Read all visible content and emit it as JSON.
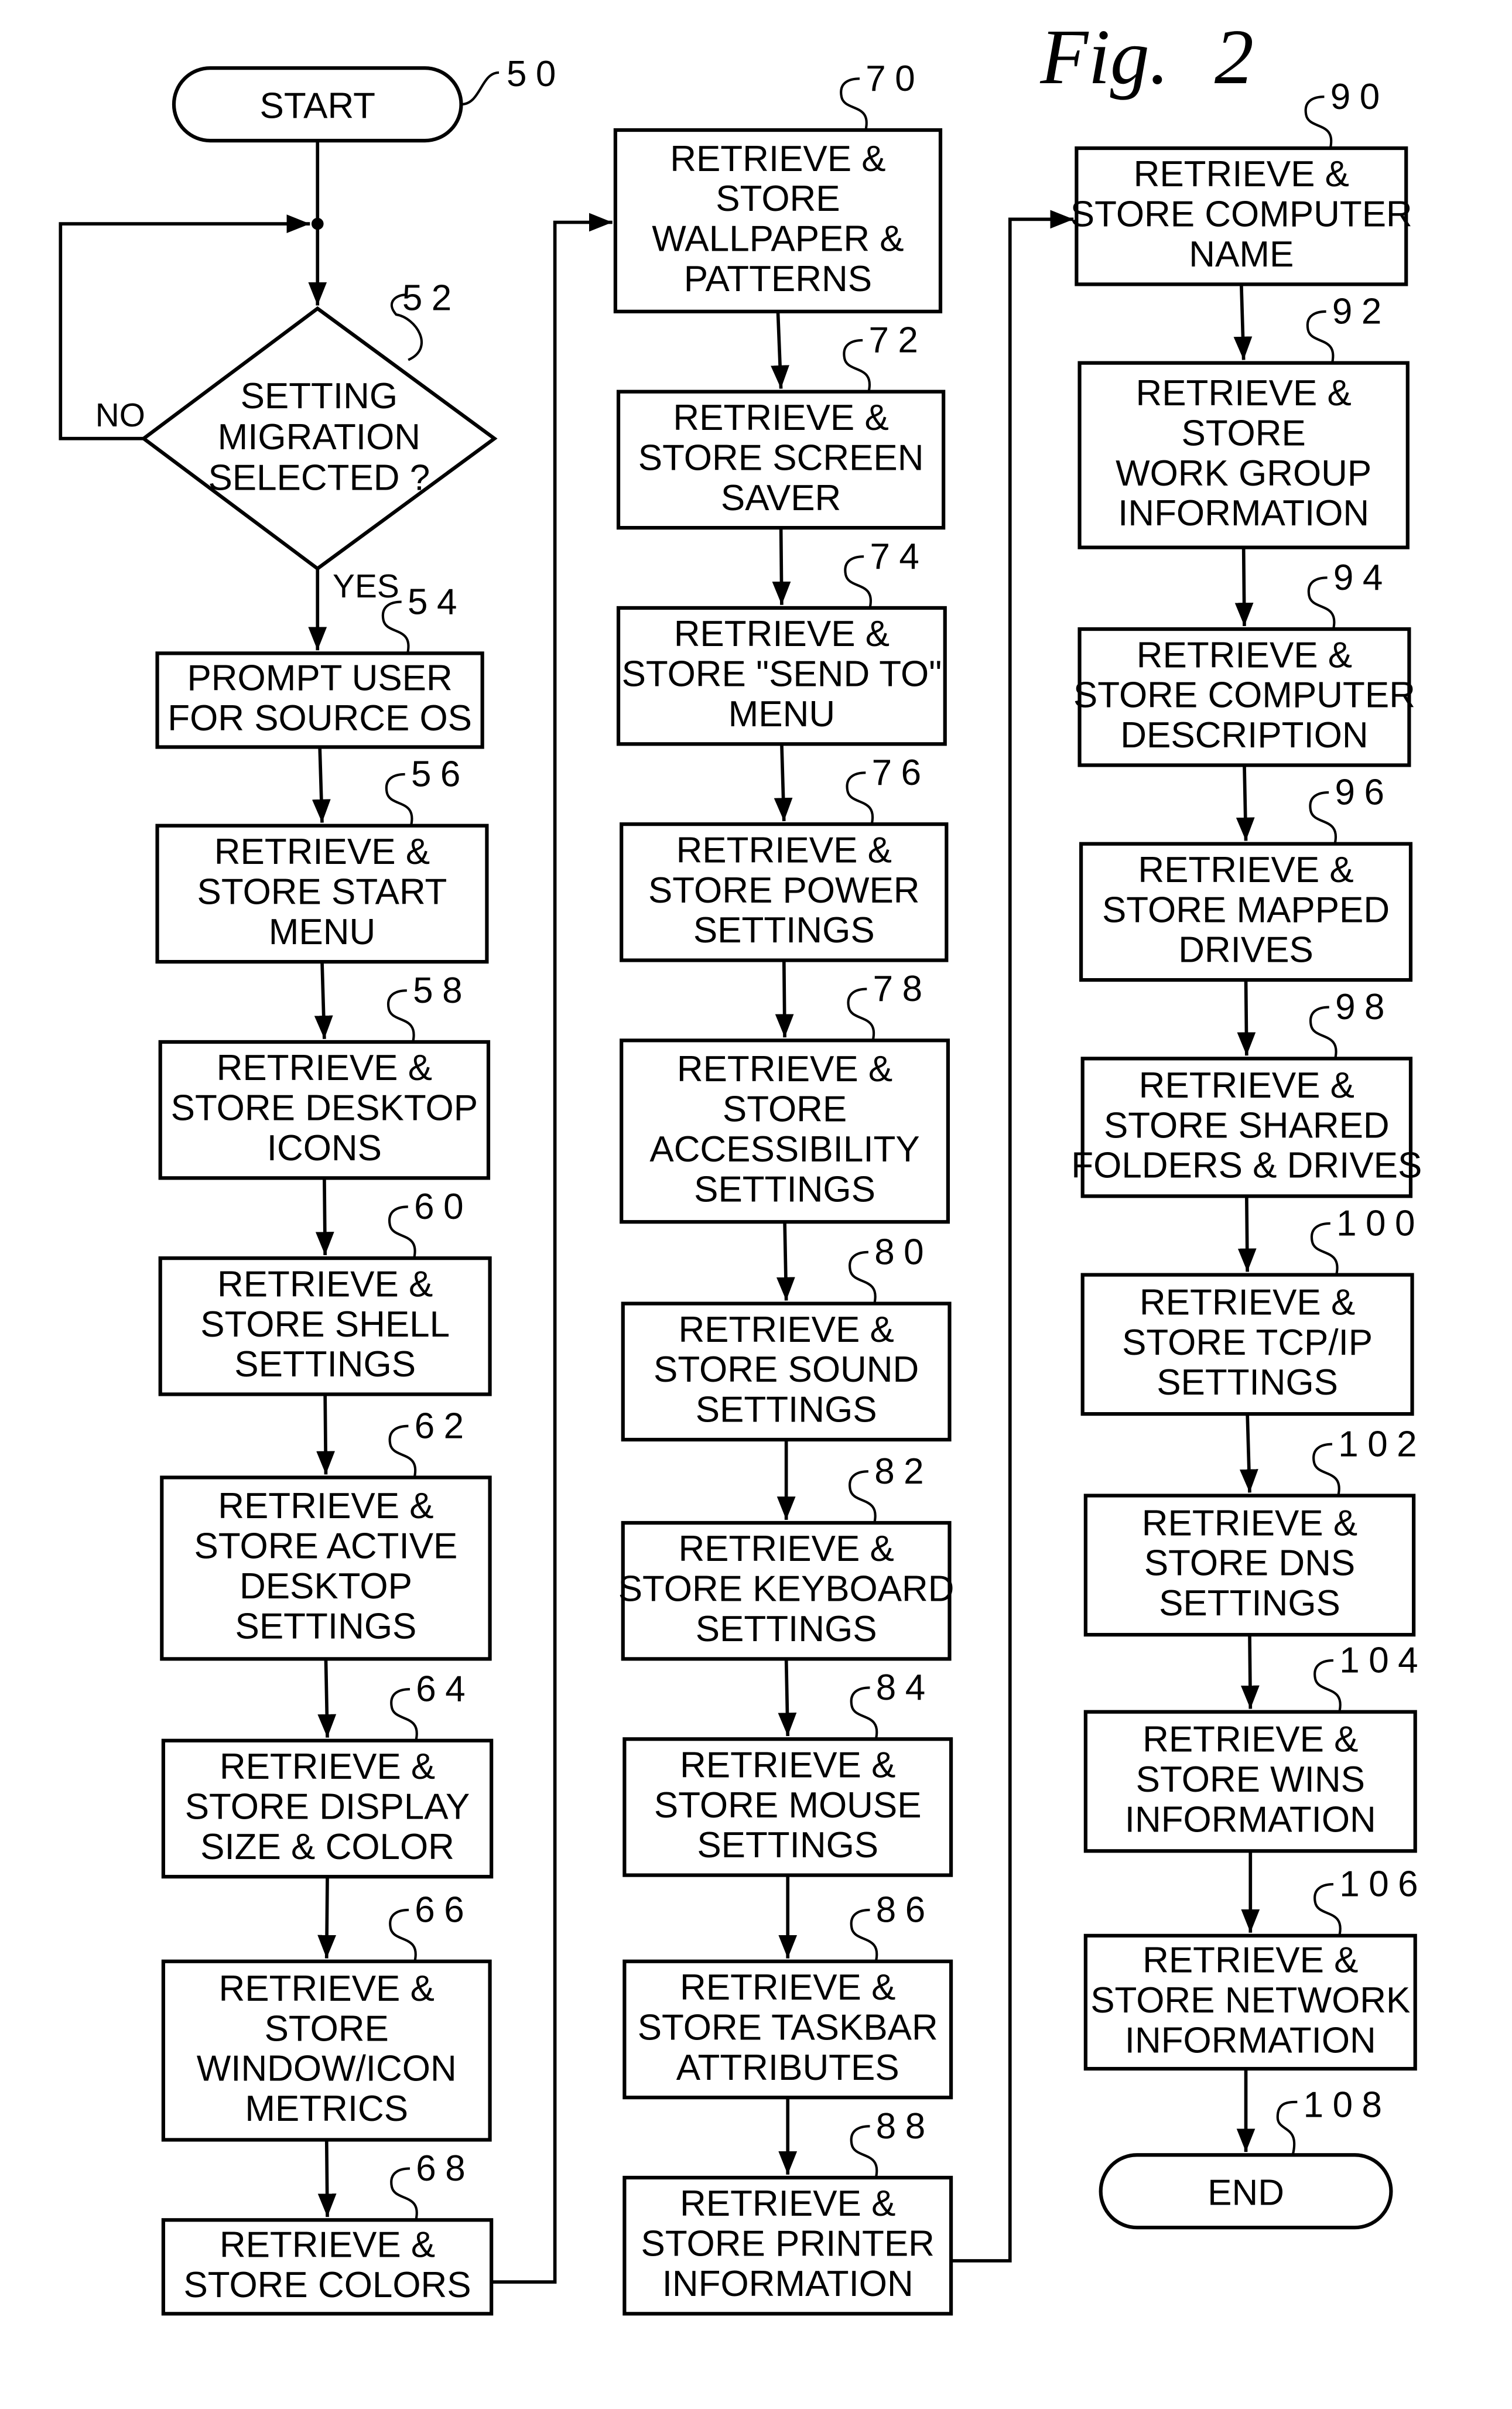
{
  "figure": {
    "title": "Fig.",
    "number": "2"
  },
  "start": {
    "label": "START",
    "ref": "50"
  },
  "decision": {
    "ref": "52",
    "lines": [
      "SETTING",
      "MIGRATION",
      "SELECTED ?"
    ],
    "yes_label": "YES",
    "no_label": "NO"
  },
  "end": {
    "label": "END",
    "ref": "108"
  },
  "steps": [
    {
      "ref": "54",
      "lines": [
        "PROMPT USER",
        "FOR SOURCE OS"
      ]
    },
    {
      "ref": "56",
      "lines": [
        "RETRIEVE &",
        "STORE START",
        "MENU"
      ]
    },
    {
      "ref": "58",
      "lines": [
        "RETRIEVE &",
        "STORE DESKTOP",
        "ICONS"
      ]
    },
    {
      "ref": "60",
      "lines": [
        "RETRIEVE &",
        "STORE SHELL",
        "SETTINGS"
      ]
    },
    {
      "ref": "62",
      "lines": [
        "RETRIEVE &",
        "STORE ACTIVE",
        "DESKTOP",
        "SETTINGS"
      ]
    },
    {
      "ref": "64",
      "lines": [
        "RETRIEVE &",
        "STORE DISPLAY",
        "SIZE & COLOR"
      ]
    },
    {
      "ref": "66",
      "lines": [
        "RETRIEVE &",
        "STORE",
        "WINDOW/ICON",
        "METRICS"
      ]
    },
    {
      "ref": "68",
      "lines": [
        "RETRIEVE &",
        "STORE COLORS"
      ]
    },
    {
      "ref": "70",
      "lines": [
        "RETRIEVE &",
        "STORE",
        "WALLPAPER &",
        "PATTERNS"
      ]
    },
    {
      "ref": "72",
      "lines": [
        "RETRIEVE &",
        "STORE SCREEN",
        "SAVER"
      ]
    },
    {
      "ref": "74",
      "lines": [
        "RETRIEVE &",
        "STORE \"SEND TO\"",
        "MENU"
      ]
    },
    {
      "ref": "76",
      "lines": [
        "RETRIEVE &",
        "STORE POWER",
        "SETTINGS"
      ]
    },
    {
      "ref": "78",
      "lines": [
        "RETRIEVE &",
        "STORE",
        "ACCESSIBILITY",
        "SETTINGS"
      ]
    },
    {
      "ref": "80",
      "lines": [
        "RETRIEVE &",
        "STORE SOUND",
        "SETTINGS"
      ]
    },
    {
      "ref": "82",
      "lines": [
        "RETRIEVE &",
        "STORE KEYBOARD",
        "SETTINGS"
      ]
    },
    {
      "ref": "84",
      "lines": [
        "RETRIEVE &",
        "STORE MOUSE",
        "SETTINGS"
      ]
    },
    {
      "ref": "86",
      "lines": [
        "RETRIEVE &",
        "STORE TASKBAR",
        "ATTRIBUTES"
      ]
    },
    {
      "ref": "88",
      "lines": [
        "RETRIEVE &",
        "STORE PRINTER",
        "INFORMATION"
      ]
    },
    {
      "ref": "90",
      "lines": [
        "RETRIEVE &",
        "STORE COMPUTER",
        "NAME"
      ]
    },
    {
      "ref": "92",
      "lines": [
        "RETRIEVE &",
        "STORE",
        "WORK GROUP",
        "INFORMATION"
      ]
    },
    {
      "ref": "94",
      "lines": [
        "RETRIEVE &",
        "STORE COMPUTER",
        "DESCRIPTION"
      ]
    },
    {
      "ref": "96",
      "lines": [
        "RETRIEVE &",
        "STORE MAPPED",
        "DRIVES"
      ]
    },
    {
      "ref": "98",
      "lines": [
        "RETRIEVE &",
        "STORE SHARED",
        "FOLDERS & DRIVES"
      ]
    },
    {
      "ref": "100",
      "lines": [
        "RETRIEVE &",
        "STORE TCP/IP",
        "SETTINGS"
      ]
    },
    {
      "ref": "102",
      "lines": [
        "RETRIEVE &",
        "STORE DNS",
        "SETTINGS"
      ]
    },
    {
      "ref": "104",
      "lines": [
        "RETRIEVE &",
        "STORE WINS",
        "INFORMATION"
      ]
    },
    {
      "ref": "106",
      "lines": [
        "RETRIEVE &",
        "STORE NETWORK",
        "INFORMATION"
      ]
    }
  ]
}
